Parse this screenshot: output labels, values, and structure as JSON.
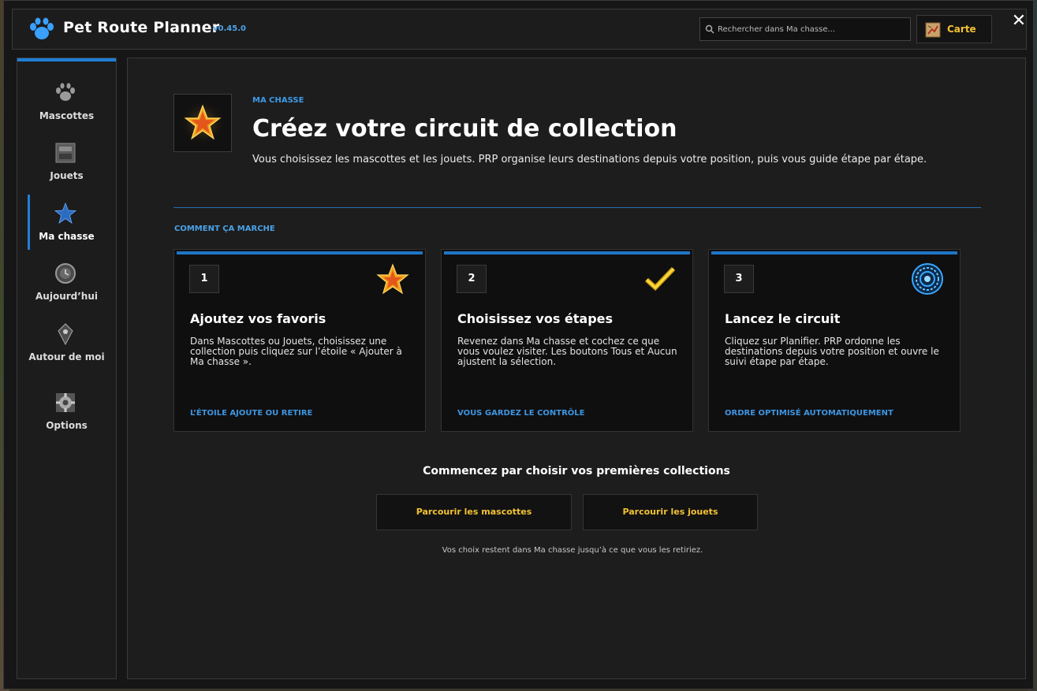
{
  "app": {
    "title": "Pet Route Planner",
    "version": "v0.45.0"
  },
  "search": {
    "placeholder": "Rechercher dans Ma chasse..."
  },
  "header": {
    "map_label": "Carte",
    "close_label": "✕"
  },
  "sidebar": {
    "items": [
      {
        "label": "Mascottes",
        "icon": "paw-icon",
        "active": false
      },
      {
        "label": "Jouets",
        "icon": "toy-chest-icon",
        "active": false
      },
      {
        "label": "Ma chasse",
        "icon": "star-icon",
        "active": true
      },
      {
        "label": "Aujourd’hui",
        "icon": "clock-icon",
        "active": false
      },
      {
        "label": "Autour de moi",
        "icon": "compass-icon",
        "active": false
      },
      {
        "label": "Options",
        "icon": "gear-icon",
        "active": false
      }
    ]
  },
  "hero": {
    "kicker": "MA CHASSE",
    "title": "Créez votre circuit de collection",
    "description": "Vous choisissez les mascottes et les jouets. PRP organise leurs destinations depuis votre position, puis vous guide étape par étape."
  },
  "how_it_works": {
    "label": "COMMENT ÇA MARCHE",
    "steps": [
      {
        "number": "1",
        "icon": "star-icon",
        "title": "Ajoutez vos favoris",
        "description": "Dans Mascottes ou Jouets, choisissez une collection puis cliquez sur l’étoile « Ajouter à Ma chasse ».",
        "footer": "L’ÉTOILE AJOUTE OU RETIRE"
      },
      {
        "number": "2",
        "icon": "checkmark-icon",
        "title": "Choisissez vos étapes",
        "description": "Revenez dans Ma chasse et cochez ce que vous voulez visiter. Les boutons Tous et Aucun ajustent la sélection.",
        "footer": "VOUS GARDEZ LE CONTRÔLE"
      },
      {
        "number": "3",
        "icon": "portal-icon",
        "title": "Lancez le circuit",
        "description": "Cliquez sur Planifier. PRP ordonne les destinations depuis votre position et ouvre le suivi étape par étape.",
        "footer": "ORDRE OPTIMISÉ AUTOMATIQUEMENT"
      }
    ]
  },
  "cta": {
    "title": "Commencez par choisir vos premières collections",
    "browse_pets": "Parcourir les mascottes",
    "browse_toys": "Parcourir les jouets",
    "note": "Vos choix restent dans Ma chasse jusqu’à ce que vous les retiriez."
  },
  "colors": {
    "accent_blue": "#1f7fd6",
    "gold": "#f2c233",
    "panel_bg": "#1d1d1d",
    "card_bg": "#0f0f10"
  }
}
